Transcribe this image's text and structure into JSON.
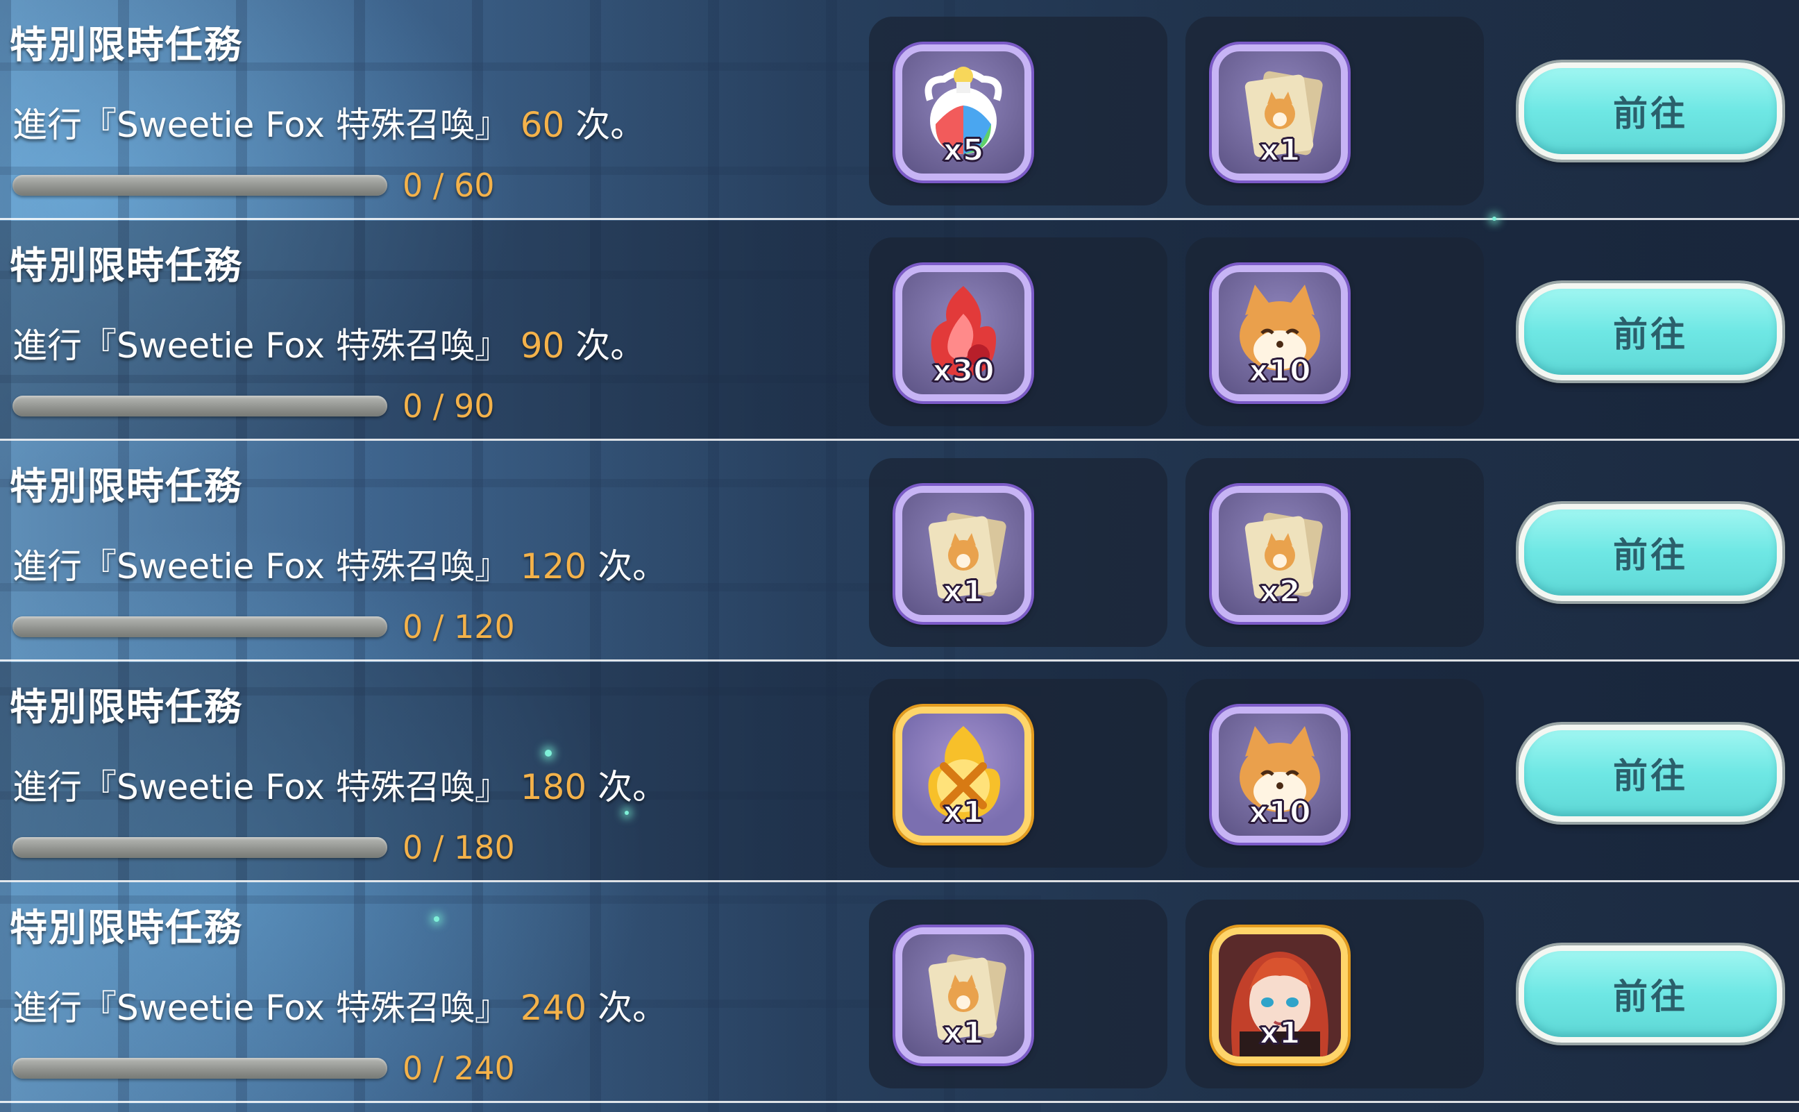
{
  "missions": [
    {
      "title": "特別限時任務",
      "desc_prefix": "進行『Sweetie Fox 特殊召喚』",
      "count": "60",
      "desc_suffix": "次。",
      "progress_text": "0 / 60",
      "progress_fraction": 0,
      "rewards": [
        {
          "icon": "rainbow-potion-icon",
          "qty": "x5",
          "frame": "purple"
        },
        {
          "icon": "fox-summon-ticket-icon",
          "qty": "x1",
          "frame": "purple"
        }
      ],
      "button_label": "前往"
    },
    {
      "title": "特別限時任務",
      "desc_prefix": "進行『Sweetie Fox 特殊召喚』",
      "count": "90",
      "desc_suffix": "次。",
      "progress_text": "0 / 90",
      "progress_fraction": 0,
      "rewards": [
        {
          "icon": "red-flame-crystal-icon",
          "qty": "x30",
          "frame": "purple"
        },
        {
          "icon": "fox-head-icon",
          "qty": "x10",
          "frame": "purple"
        }
      ],
      "button_label": "前往"
    },
    {
      "title": "特別限時任務",
      "desc_prefix": "進行『Sweetie Fox 特殊召喚』",
      "count": "120",
      "desc_suffix": "次。",
      "progress_text": "0 / 120",
      "progress_fraction": 0,
      "rewards": [
        {
          "icon": "fox-summon-ticket-icon",
          "qty": "x1",
          "frame": "purple"
        },
        {
          "icon": "fox-summon-ticket-icon",
          "qty": "x2",
          "frame": "purple"
        }
      ],
      "button_label": "前往"
    },
    {
      "title": "特別限時任務",
      "desc_prefix": "進行『Sweetie Fox 特殊召喚』",
      "count": "180",
      "desc_suffix": "次。",
      "progress_text": "0 / 180",
      "progress_fraction": 0,
      "rewards": [
        {
          "icon": "golden-flame-emblem-icon",
          "qty": "x1",
          "frame": "gold"
        },
        {
          "icon": "fox-head-icon",
          "qty": "x10",
          "frame": "purple"
        }
      ],
      "button_label": "前往"
    },
    {
      "title": "特別限時任務",
      "desc_prefix": "進行『Sweetie Fox 特殊召喚』",
      "count": "240",
      "desc_suffix": "次。",
      "progress_text": "0 / 240",
      "progress_fraction": 0,
      "rewards": [
        {
          "icon": "fox-summon-ticket-icon",
          "qty": "x1",
          "frame": "purple"
        },
        {
          "icon": "red-haired-character-portrait-icon",
          "qty": "x1",
          "frame": "gold"
        }
      ],
      "button_label": "前往"
    }
  ],
  "colors": {
    "count_highlight": "#f4b24a",
    "button_fill": "#6ee7e4",
    "button_text": "#2b5f6b",
    "item_frame_purple": "#c7b4f5",
    "item_frame_gold": "#ffd56a"
  }
}
